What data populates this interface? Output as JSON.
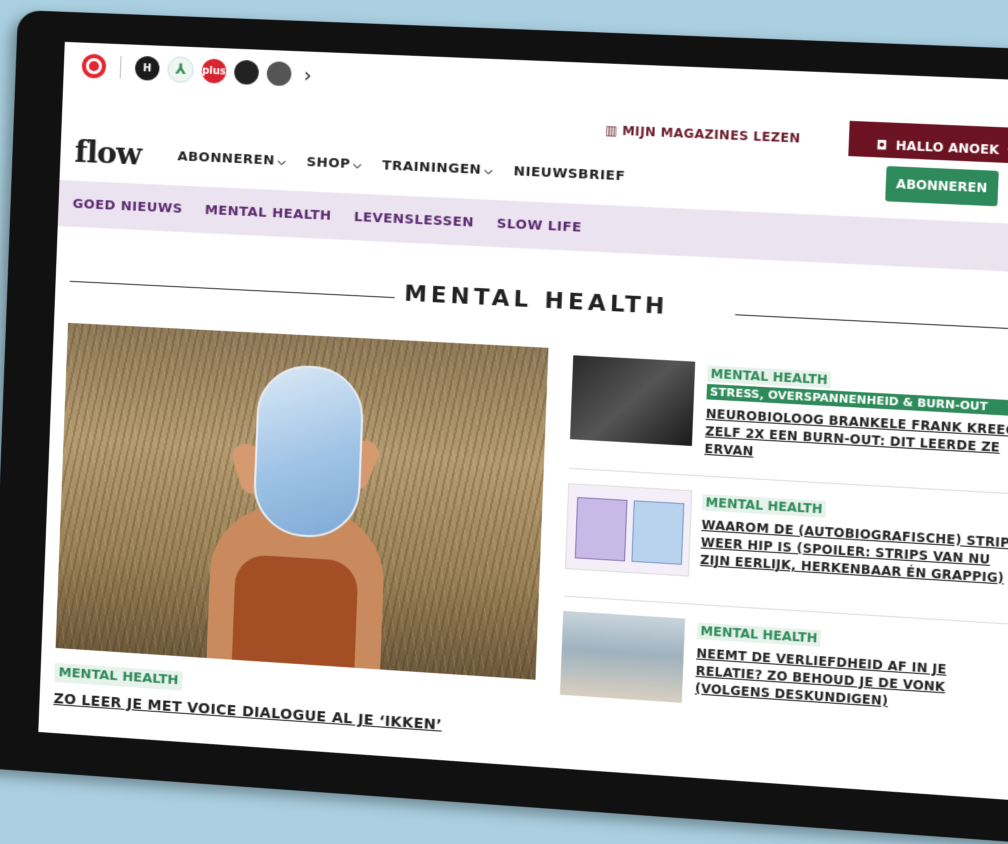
{
  "browser": {
    "apps": [
      {
        "name": "app-icon-red",
        "label": "",
        "color": "#e3262f"
      },
      {
        "name": "app-icon-h",
        "label": "H",
        "color": "#1b1b1b"
      },
      {
        "name": "app-icon-green",
        "label": "",
        "color": "#2e8a5a"
      },
      {
        "name": "app-icon-plus",
        "label": "plus",
        "color": "#d8242f"
      },
      {
        "name": "app-icon-dark",
        "label": "",
        "color": "#222"
      },
      {
        "name": "app-icon-grey",
        "label": "",
        "color": "#555"
      }
    ]
  },
  "header": {
    "magazines_label": "MIJN MAGAZINES LEZEN",
    "greeting": "HALLO ANOEK",
    "logo": "flow",
    "nav": [
      {
        "label": "ABONNEREN"
      },
      {
        "label": "SHOP"
      },
      {
        "label": "TRAININGEN"
      },
      {
        "label": "NIEUWSBRIEF"
      }
    ],
    "subscribe_label": "ABONNEREN"
  },
  "subnav": [
    "GOED NIEUWS",
    "MENTAL HEALTH",
    "LEVENSLESSEN",
    "SLOW LIFE"
  ],
  "page": {
    "title": "MENTAL HEALTH"
  },
  "hero": {
    "category": "MENTAL HEALTH",
    "headline": "ZO LEER JE MET VOICE DIALOGUE AL JE ‘IKKEN’"
  },
  "articles": [
    {
      "category": "MENTAL HEALTH",
      "tag": "STRESS, OVERSPANNENHEID & BURN-OUT",
      "headline": "NEUROBIOLOOG BRANKELE FRANK KREEG ZELF 2X EEN BURN-OUT: DIT LEERDE ZE ERVAN"
    },
    {
      "category": "MENTAL HEALTH",
      "tag": "",
      "headline": "WAAROM DE (AUTOBIOGRAFISCHE) STRIP WEER HIP IS (SPOILER: STRIPS VAN NU ZIJN EERLIJK, HERKENBAAR ÉN GRAPPIG)"
    },
    {
      "category": "MENTAL HEALTH",
      "tag": "",
      "headline": "NEEMT DE VERLIEFDHEID AF IN JE RELATIE? ZO BEHOUD JE DE VONK (VOLGENS DESKUNDIGEN)"
    }
  ],
  "colors": {
    "accent": "#2e8a5a",
    "brand": "#6b1322",
    "subnav_bg": "#ece3f1"
  }
}
